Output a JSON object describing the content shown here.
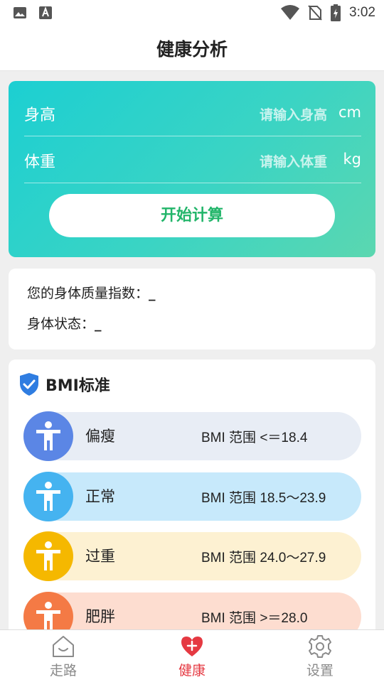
{
  "status_bar": {
    "time": "3:02",
    "left_icons": [
      "image-icon",
      "text-a-icon"
    ],
    "right_icons": [
      "wifi-icon",
      "no-sim-icon",
      "battery-charging-icon"
    ]
  },
  "header": {
    "title": "健康分析"
  },
  "calculator": {
    "height_label": "身高",
    "height_placeholder": "请输入身高",
    "height_unit": "cm",
    "weight_label": "体重",
    "weight_placeholder": "请输入体重",
    "weight_unit": "kg",
    "button_label": "开始计算",
    "gradient_colors": [
      "#1ccfd2",
      "#5bd7b0"
    ],
    "button_text_color": "#22b56a"
  },
  "result": {
    "bmi_label": "您的身体质量指数：",
    "bmi_value": "_",
    "status_label": "身体状态：",
    "status_value": "_"
  },
  "standard": {
    "title": "BMI标准",
    "icon": "shield-check-icon",
    "items": [
      {
        "name": "偏瘦",
        "range": "BMI 范围 <＝18.4",
        "badge_color": "#5b86e5",
        "row_color": "#e8edf5"
      },
      {
        "name": "正常",
        "range": "BMI 范围 18.5～23.9",
        "badge_color": "#45b3f0",
        "row_color": "#c7e9fb"
      },
      {
        "name": "过重",
        "range": "BMI 范围 24.0～27.9",
        "badge_color": "#f5b800",
        "row_color": "#fdf1d2"
      },
      {
        "name": "肥胖",
        "range": "BMI 范围 >＝28.0",
        "badge_color": "#f47a45",
        "row_color": "#fdddd0"
      }
    ]
  },
  "bottom_nav": {
    "items": [
      {
        "label": "走路",
        "icon": "home-smile-icon",
        "active": false
      },
      {
        "label": "健康",
        "icon": "heart-plus-icon",
        "active": true
      },
      {
        "label": "设置",
        "icon": "gear-icon",
        "active": false
      }
    ],
    "active_color": "#e53942"
  }
}
